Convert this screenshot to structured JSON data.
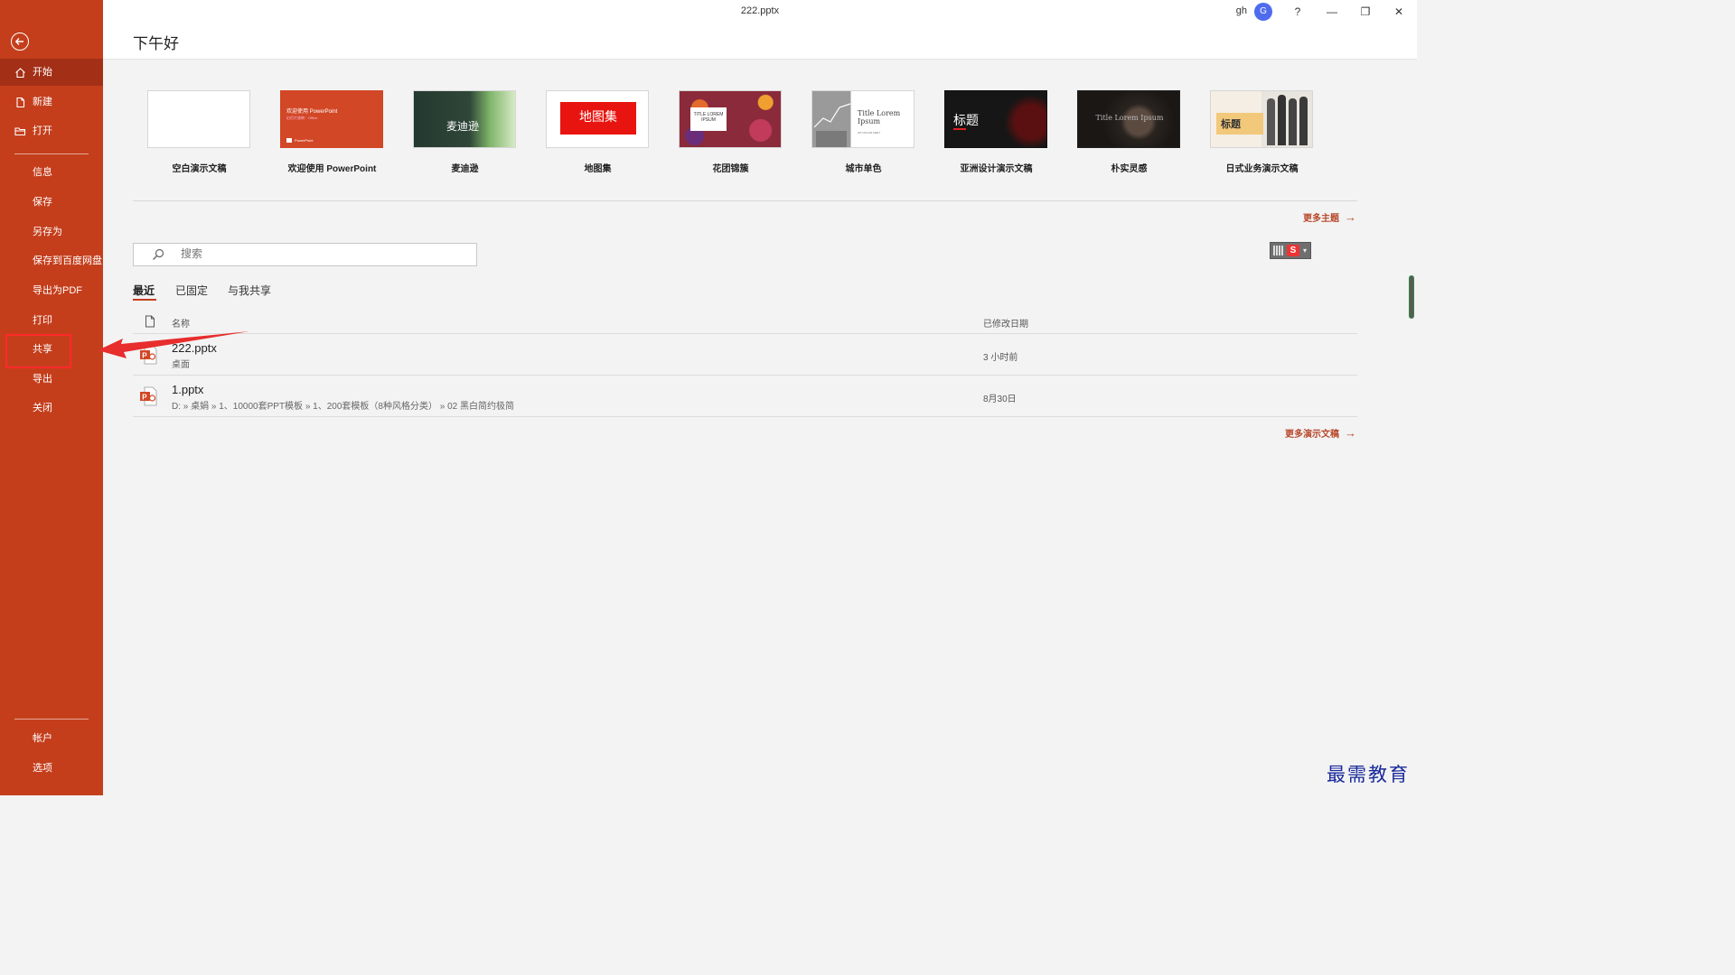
{
  "window": {
    "title": "222.pptx",
    "user": "gh",
    "avatar_letter": "G",
    "help": "?",
    "minimize": "—",
    "restore": "❐",
    "close": "✕"
  },
  "sidebar": {
    "items": [
      {
        "label": "开始",
        "icon": "home-icon"
      },
      {
        "label": "新建",
        "icon": "new-doc-icon"
      },
      {
        "label": "打开",
        "icon": "folder-icon"
      },
      {
        "label": "信息"
      },
      {
        "label": "保存"
      },
      {
        "label": "另存为"
      },
      {
        "label": "保存到百度网盘"
      },
      {
        "label": "导出为PDF"
      },
      {
        "label": "打印"
      },
      {
        "label": "共享"
      },
      {
        "label": "导出"
      },
      {
        "label": "关闭"
      },
      {
        "label": "帐户"
      },
      {
        "label": "选项"
      }
    ],
    "active": "开始",
    "accent": "#c43e1c"
  },
  "header": {
    "greeting": "下午好"
  },
  "templates": [
    {
      "label": "空白演示文稿"
    },
    {
      "label": "欢迎使用 PowerPoint",
      "thumb_title": "欢迎使用 PowerPoint",
      "thumb_sub": "幻灯片放映：Office",
      "thumb_brand": "PowerPoint"
    },
    {
      "label": "麦迪逊",
      "thumb_title": "麦迪逊"
    },
    {
      "label": "地图集",
      "thumb_title": "地图集"
    },
    {
      "label": "花团锦簇",
      "thumb_title": "TITLE LOREM IPSUM"
    },
    {
      "label": "城市单色",
      "thumb_title": "Title Lorem Ipsum",
      "thumb_sub": "SIT DOLOR AMET"
    },
    {
      "label": "亚洲设计演示文稿",
      "thumb_title": "标题"
    },
    {
      "label": "朴实灵感",
      "thumb_title": "Title Lorem Ipsum"
    },
    {
      "label": "日式业务演示文稿",
      "thumb_title": "标题"
    }
  ],
  "more_themes": "更多主题",
  "search": {
    "placeholder": "搜索"
  },
  "tabs": [
    "最近",
    "已固定",
    "与我共享"
  ],
  "columns": {
    "name": "名称",
    "modified": "已修改日期"
  },
  "files": [
    {
      "name": "222.pptx",
      "path": "桌面",
      "date": "3 小时前"
    },
    {
      "name": "1.pptx",
      "path": "D: » 桌娟 » 1、10000套PPT模板 » 1、200套模板（8种风格分类） » 02 黑白简约极简",
      "date": "8月30日"
    }
  ],
  "more_presentations": "更多演示文稿",
  "watermark": "最需教育"
}
